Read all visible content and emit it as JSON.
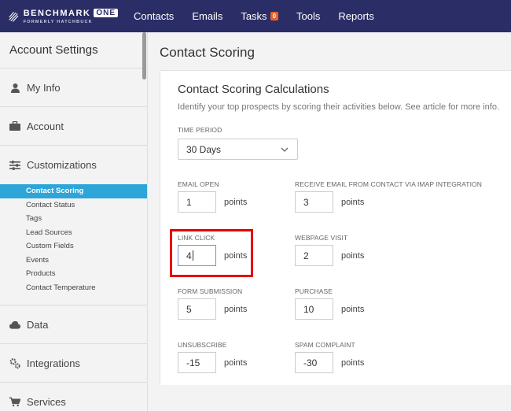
{
  "logo": {
    "name": "BENCHMARK",
    "one": "ONE",
    "sub": "FORMERLY HATCHBUCK"
  },
  "nav": [
    {
      "label": "Contacts"
    },
    {
      "label": "Emails"
    },
    {
      "label": "Tasks",
      "badge": "0"
    },
    {
      "label": "Tools"
    },
    {
      "label": "Reports"
    }
  ],
  "sidebar": {
    "title": "Account Settings",
    "sections": [
      {
        "label": "My Info",
        "icon": "person-icon"
      },
      {
        "label": "Account",
        "icon": "briefcase-icon"
      },
      {
        "label": "Customizations",
        "icon": "sliders-icon"
      },
      {
        "label": "Data",
        "icon": "cloud-icon"
      },
      {
        "label": "Integrations",
        "icon": "gears-icon"
      },
      {
        "label": "Services",
        "icon": "cart-icon"
      }
    ],
    "sub_items": [
      "Contact Scoring",
      "Contact Status",
      "Tags",
      "Lead Sources",
      "Custom Fields",
      "Events",
      "Products",
      "Contact Temperature"
    ]
  },
  "page_title": "Contact Scoring",
  "card": {
    "title": "Contact Scoring Calculations",
    "description": "Identify your top prospects by scoring their activities below. See article for more info.",
    "time_period_label": "TIME PERIOD",
    "time_period_value": "30 Days",
    "points_label": "points",
    "fields": {
      "email_open": {
        "label": "EMAIL OPEN",
        "value": "1"
      },
      "receive_email": {
        "label": "RECEIVE EMAIL FROM CONTACT VIA IMAP INTEGRATION",
        "value": "3"
      },
      "link_click": {
        "label": "LINK CLICK",
        "value": "4"
      },
      "webpage_visit": {
        "label": "WEBPAGE VISIT",
        "value": "2"
      },
      "form_submission": {
        "label": "FORM SUBMISSION",
        "value": "5"
      },
      "purchase": {
        "label": "PURCHASE",
        "value": "10"
      },
      "unsubscribe": {
        "label": "UNSUBSCRIBE",
        "value": "-15"
      },
      "spam_complaint": {
        "label": "SPAM COMPLAINT",
        "value": "-30"
      }
    }
  },
  "colors": {
    "nav_bg": "#2b2d66",
    "active_item": "#2ea5d8",
    "highlight": "#e60000",
    "badge": "#e8622c"
  }
}
